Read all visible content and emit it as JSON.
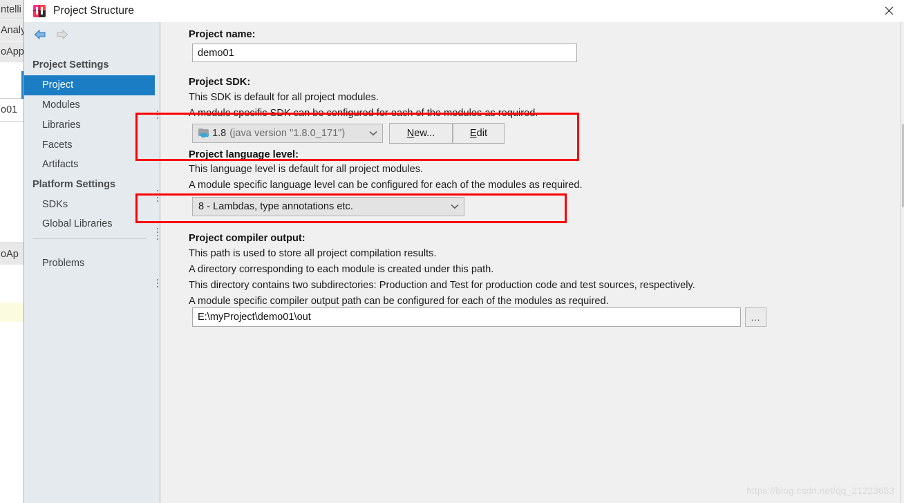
{
  "window": {
    "title": "Project Structure",
    "app_icon": "intellij-idea-icon",
    "close_label": "✕"
  },
  "background_ide": {
    "strips": [
      {
        "text": "ntelli"
      },
      {
        "text": "Analy"
      },
      {
        "text": "oApp"
      },
      {
        "text": "o01"
      },
      {
        "text": "oAp"
      }
    ]
  },
  "sidebar": {
    "nav": {
      "back": "back-arrow",
      "forward": "forward-arrow"
    },
    "groups": [
      {
        "title": "Project Settings",
        "items": [
          {
            "label": "Project",
            "selected": true
          },
          {
            "label": "Modules",
            "selected": false
          },
          {
            "label": "Libraries",
            "selected": false
          },
          {
            "label": "Facets",
            "selected": false
          },
          {
            "label": "Artifacts",
            "selected": false
          }
        ]
      },
      {
        "title": "Platform Settings",
        "items": [
          {
            "label": "SDKs",
            "selected": false
          },
          {
            "label": "Global Libraries",
            "selected": false
          }
        ]
      }
    ],
    "footer_items": [
      {
        "label": "Problems"
      }
    ]
  },
  "content": {
    "project_name": {
      "label": "Project name:",
      "value": "demo01"
    },
    "project_sdk": {
      "label": "Project SDK:",
      "description_lines": [
        "This SDK is default for all project modules.",
        "A module specific SDK can be configured for each of the modules as required."
      ],
      "selected_name": "1.8",
      "selected_version": "(java version \"1.8.0_171\")",
      "new_button": {
        "prefix": "",
        "mnemonic": "N",
        "suffix": "ew..."
      },
      "edit_button": {
        "prefix": "",
        "mnemonic": "E",
        "suffix": "dit"
      }
    },
    "project_language_level": {
      "label": "Project language level:",
      "description_lines": [
        "This language level is default for all project modules.",
        "A module specific language level can be configured for each of the modules as required."
      ],
      "selected": "8 - Lambdas, type annotations etc."
    },
    "project_compiler_output": {
      "label": "Project compiler output:",
      "description_lines": [
        "This path is used to store all project compilation results.",
        "A directory corresponding to each module is created under this path.",
        "This directory contains two subdirectories: Production and Test for production code and test sources, respectively.",
        "A module specific compiler output path can be configured for each of the modules as required."
      ],
      "path": "E:\\myProject\\demo01\\out",
      "browse_label": "..."
    }
  },
  "annotations": {
    "color": "#fb0000",
    "boxes": [
      {
        "name": "sdk-highlight"
      },
      {
        "name": "language-level-highlight"
      }
    ]
  },
  "watermark": {
    "text": "https://blog.csdn.net/qq_21223653"
  }
}
